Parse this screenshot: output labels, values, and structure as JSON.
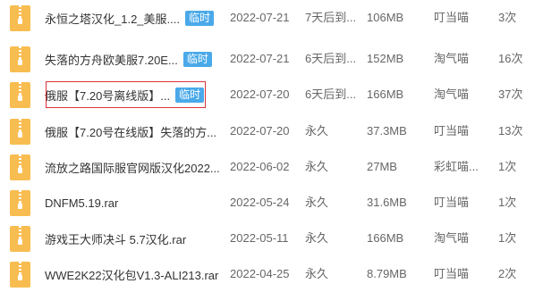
{
  "colors": {
    "folder_icon": "#f8bd50",
    "zip_band": "#ffffff",
    "badge_bg": "#4aa9e9",
    "highlight_border": "#d9333a"
  },
  "file_icon": "zip-file-icon",
  "files": [
    {
      "name": "永恒之塔汉化_1.2_美服....",
      "badge": "临时",
      "date": "2022-07-21",
      "expiry": "7天后到...",
      "size": "106MB",
      "user": "叮当喵",
      "count": "3次"
    },
    {
      "name": "失落的方舟欧美服7.20E...",
      "badge": "临时",
      "date": "2022-07-21",
      "expiry": "6天后到...",
      "size": "152MB",
      "user": "淘气喵",
      "count": "16次"
    },
    {
      "name": "俄服【7.20号离线版】...",
      "badge": "临时",
      "date": "2022-07-20",
      "expiry": "6天后到...",
      "size": "166MB",
      "user": "淘气喵",
      "count": "37次"
    },
    {
      "name": "俄服【7.20号在线版】失落的方...",
      "badge": "",
      "date": "2022-07-20",
      "expiry": "永久",
      "size": "37.3MB",
      "user": "叮当喵",
      "count": "13次"
    },
    {
      "name": "流放之路国际服官网版汉化2022...",
      "badge": "",
      "date": "2022-06-02",
      "expiry": "永久",
      "size": "27MB",
      "user": "彩虹喵...",
      "count": "1次"
    },
    {
      "name": "DNFM5.19.rar",
      "badge": "",
      "date": "2022-05-24",
      "expiry": "永久",
      "size": "31.6MB",
      "user": "叮当喵",
      "count": "1次"
    },
    {
      "name": "游戏王大师决斗 5.7汉化.rar",
      "badge": "",
      "date": "2022-05-11",
      "expiry": "永久",
      "size": "166MB",
      "user": "淘气喵",
      "count": "1次"
    },
    {
      "name": "WWE2K22汉化包V1.3-ALI213.rar",
      "badge": "",
      "date": "2022-04-25",
      "expiry": "永久",
      "size": "8.79MB",
      "user": "叮当喵",
      "count": "2次"
    }
  ]
}
